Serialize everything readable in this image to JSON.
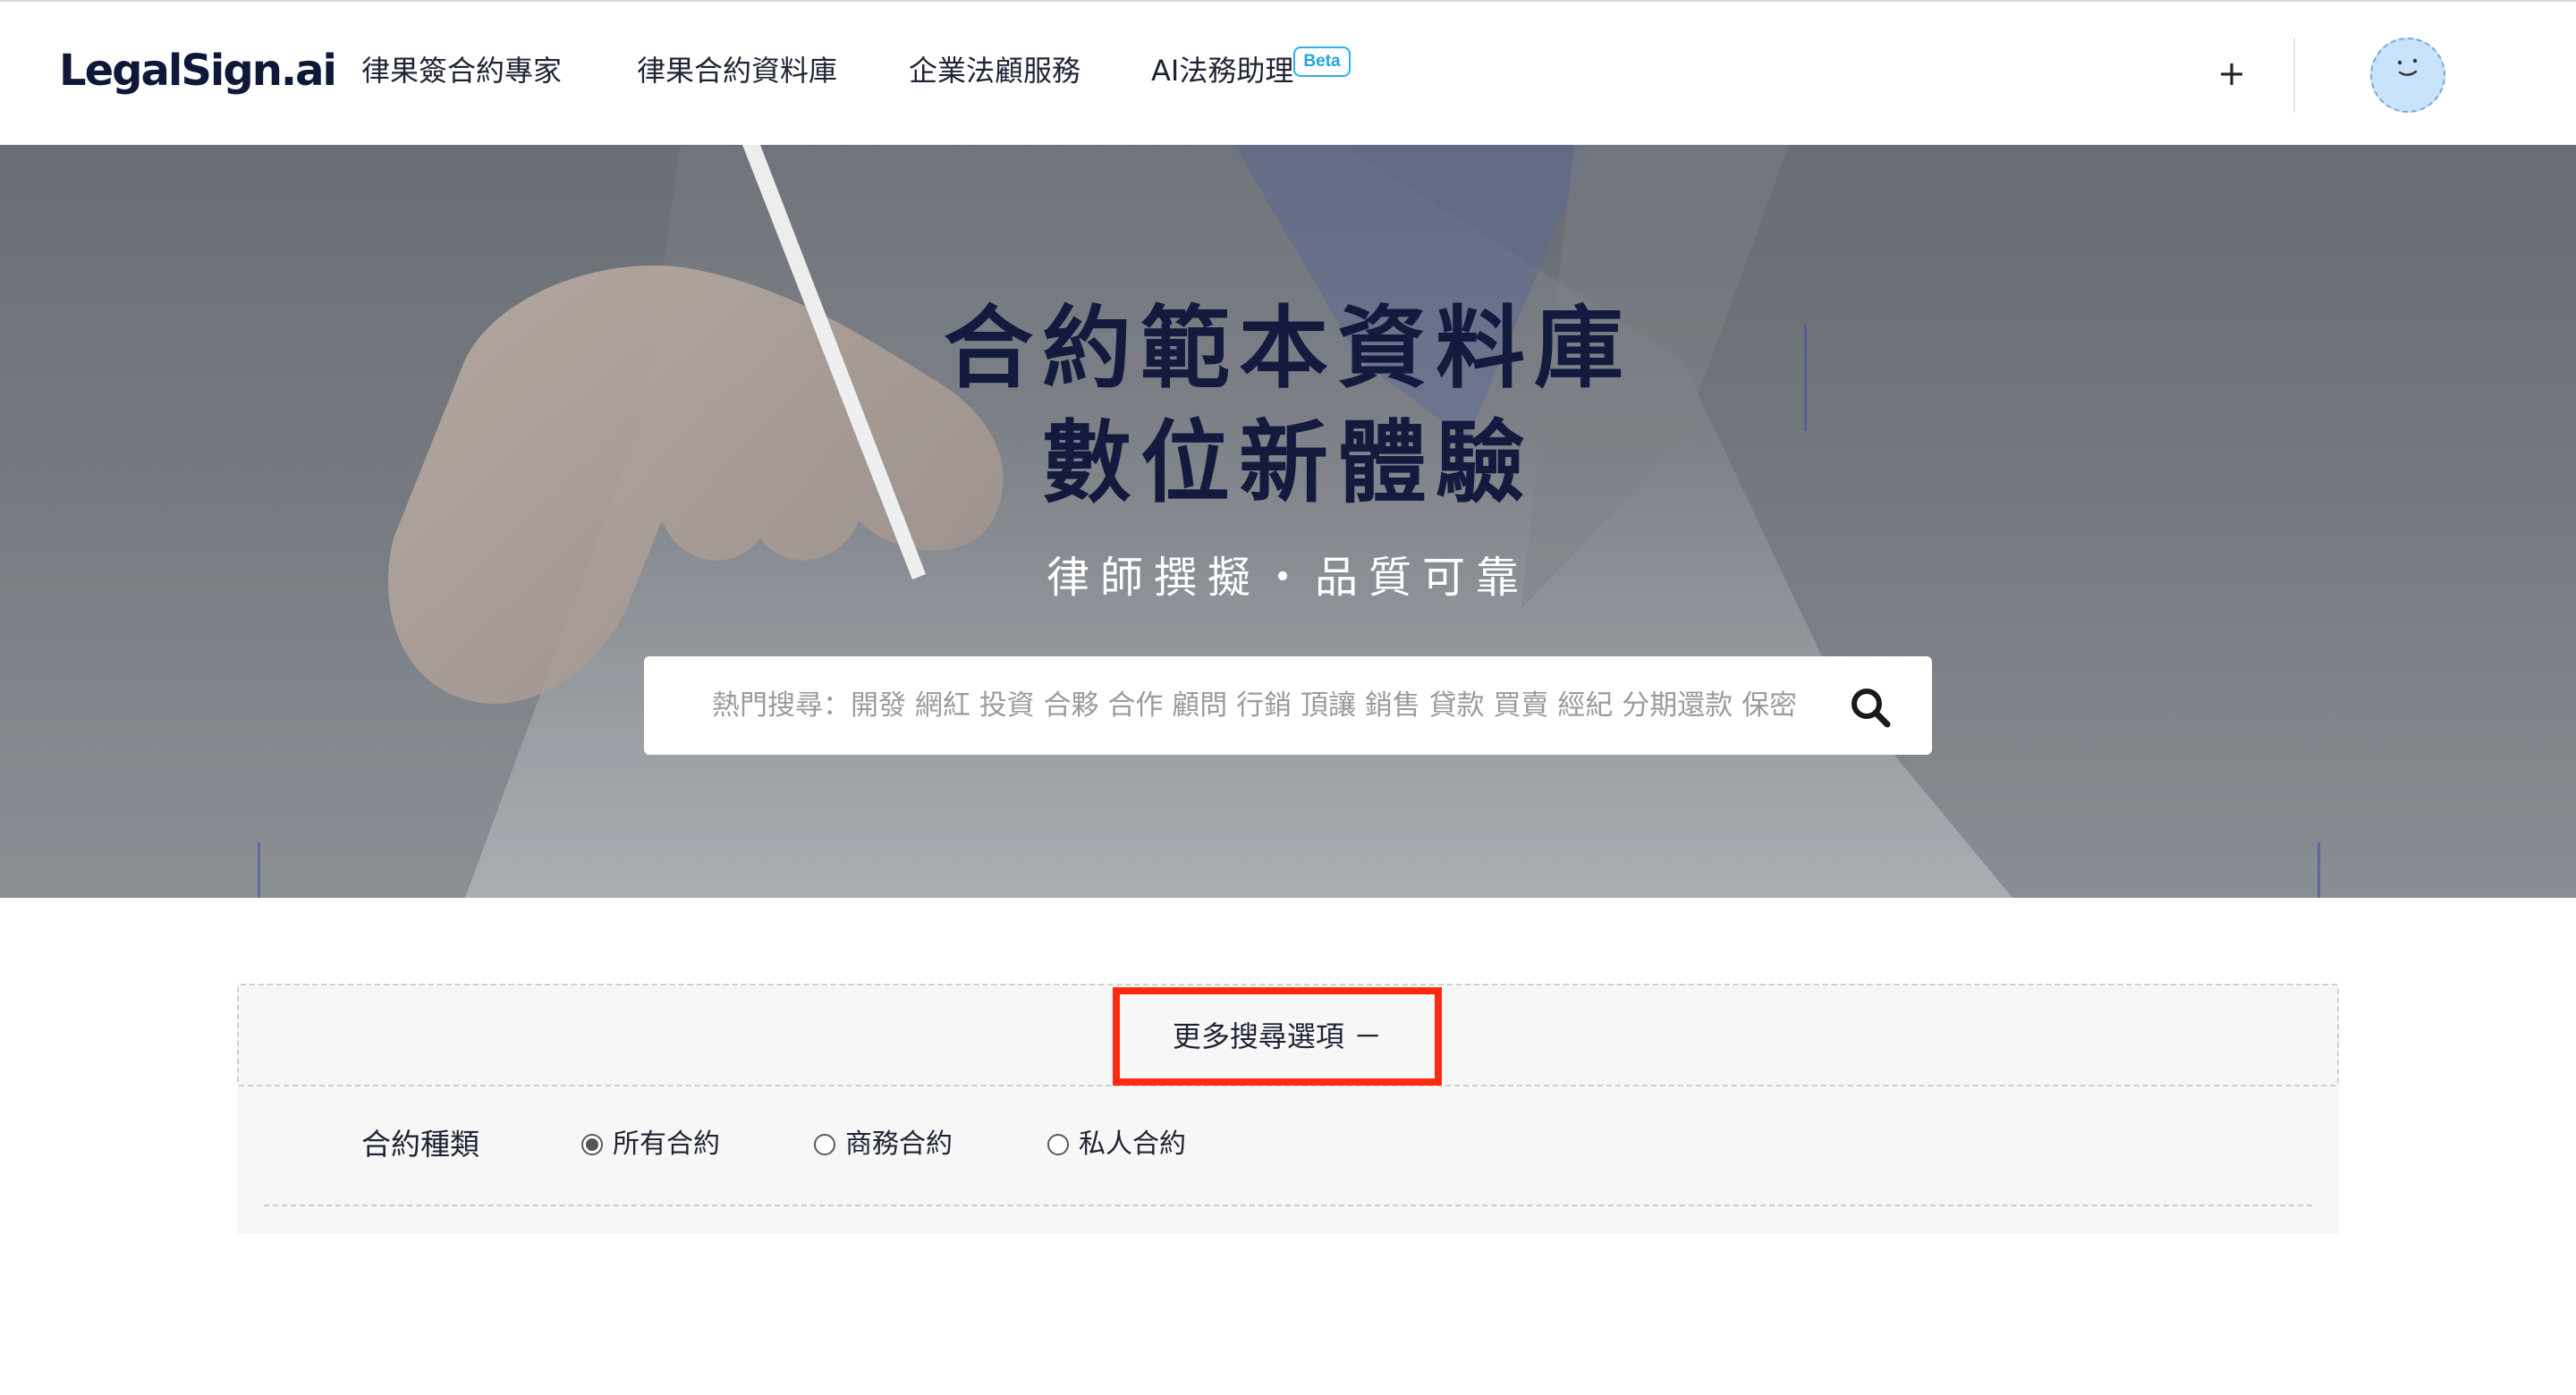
{
  "header": {
    "logo": "LegalSign.ai",
    "nav": [
      {
        "label": "律果簽合約專家"
      },
      {
        "label": "律果合約資料庫"
      },
      {
        "label": "企業法顧服務"
      },
      {
        "label": "AI法務助理",
        "badge": "Beta"
      }
    ],
    "add_label": "+"
  },
  "hero": {
    "title_line1": "合約範本資料庫",
    "title_line2": "數位新體驗",
    "subtitle": "律師撰擬・品質可靠",
    "search_placeholder": "熱門搜尋：開發 網紅 投資 合夥 合作 顧問 行銷 頂讓 銷售 貸款 買賣 經紀 分期還款 保密"
  },
  "advanced_search": {
    "toggle_label": "更多搜尋選項 －",
    "filter_label": "合約種類",
    "options": [
      {
        "label": "所有合約",
        "checked": true
      },
      {
        "label": "商務合約",
        "checked": false
      },
      {
        "label": "私人合約",
        "checked": false
      }
    ]
  },
  "colors": {
    "title_navy": "#141a3e",
    "beta_blue": "#27b3e6",
    "highlight_red": "#ff2a12",
    "avatar_blue": "#c9e3fb"
  },
  "icons": [
    "search-icon",
    "smiley-avatar-icon",
    "plus-icon"
  ]
}
